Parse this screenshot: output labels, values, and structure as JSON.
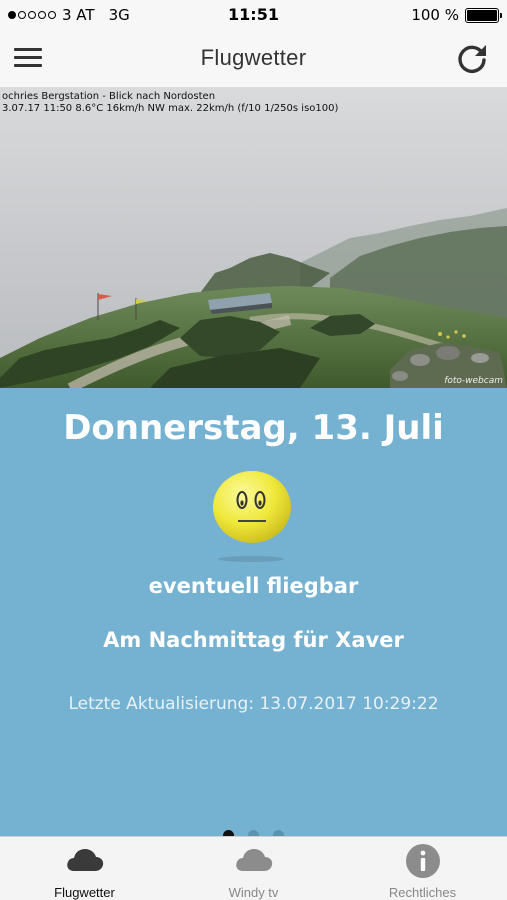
{
  "status_bar": {
    "carrier": "3 AT",
    "network": "3G",
    "time": "11:51",
    "battery": "100 %",
    "signal_bars_filled": 1,
    "signal_bars_total": 5
  },
  "nav": {
    "title": "Flugwetter",
    "menu_icon": "hamburger-menu-icon",
    "refresh_icon": "refresh-icon"
  },
  "webcam": {
    "caption_line1": "ochries Bergstation - Blick nach Nordosten",
    "caption_line2": "3.07.17 11:50   8.6°C   16km/h NW    max. 22km/h    (f/10  1/250s  iso100)",
    "watermark": "foto-webcam"
  },
  "forecast": {
    "date": "Donnerstag, 13. Juli",
    "mood_icon": "neutral-smiley-icon",
    "status": "eventuell fliegbar",
    "note": "Am Nachmittag für Xaver",
    "last_update": "Letzte Aktualisierung: 13.07.2017 10:29:22",
    "page_count": 3,
    "active_page": 1,
    "panel_color": "#75b2d1"
  },
  "tabs": [
    {
      "label": "Flugwetter",
      "icon": "cloud-icon",
      "active": true
    },
    {
      "label": "Windy tv",
      "icon": "cloud-icon",
      "active": false
    },
    {
      "label": "Rechtliches",
      "icon": "info-icon",
      "active": false
    }
  ]
}
